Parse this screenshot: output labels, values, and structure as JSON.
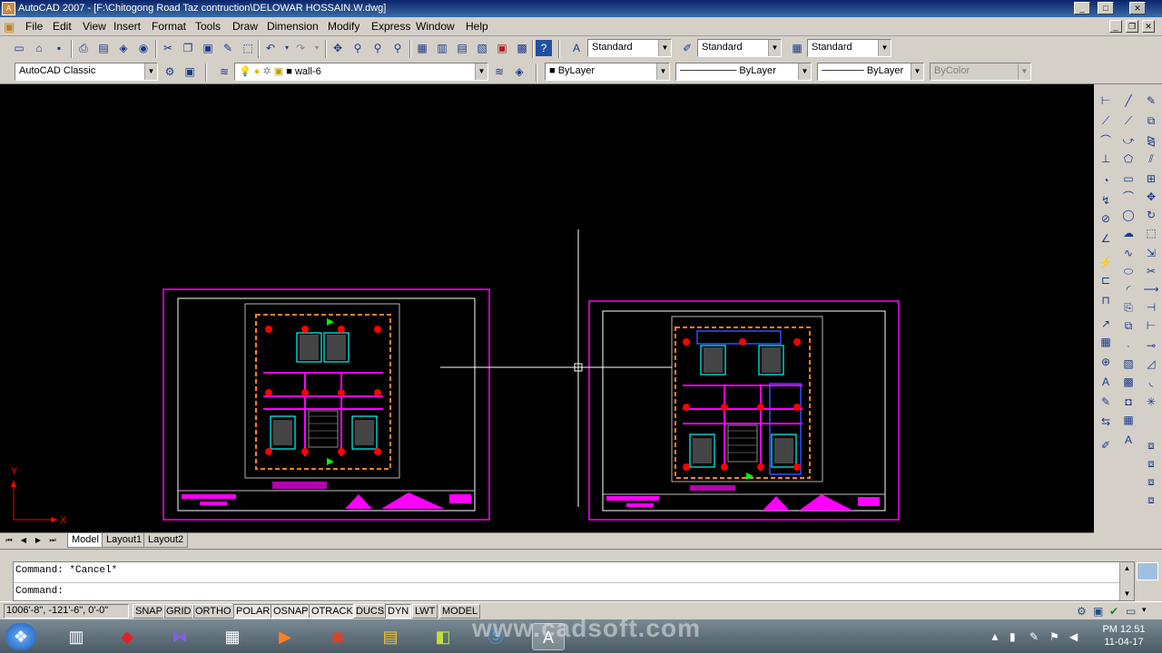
{
  "window": {
    "title": "AutoCAD 2007 - [F:\\Chitogong Road   Taz contruction\\DELOWAR HOSSAIN.W.dwg]",
    "app_icon": "A",
    "min": "_",
    "max": "□",
    "close": "✕",
    "doc_min": "_",
    "doc_restore": "❐",
    "doc_close": "✕"
  },
  "menu": [
    "File",
    "Edit",
    "View",
    "Insert",
    "Format",
    "Tools",
    "Draw",
    "Dimension",
    "Modify",
    "Express",
    "Window",
    "Help"
  ],
  "styles_toolbar": {
    "text_style": "Standard",
    "dim_style": "Standard",
    "table_style": "Standard"
  },
  "workspace": "AutoCAD Classic",
  "layer": "wall-6",
  "properties": {
    "color": "ByLayer",
    "linetype": "ByLayer",
    "lineweight": "ByLayer",
    "plotstyle": "ByColor"
  },
  "tabs": {
    "model": "Model",
    "layout1": "Layout1",
    "layout2": "Layout2"
  },
  "command": {
    "line1": "Command: *Cancel*",
    "line2": "Command:"
  },
  "status": {
    "coords": "1006'-8\", -121'-6\", 0'-0\"",
    "buttons": [
      "SNAP",
      "GRID",
      "ORTHO",
      "POLAR",
      "OSNAP",
      "OTRACK",
      "DUCS",
      "DYN",
      "LWT",
      "MODEL"
    ]
  },
  "ucs": {
    "x_label": "X",
    "y_label": "Y"
  },
  "taskbar": {
    "watermark": "www.cadsoft.com",
    "time": "PM 12.51",
    "date": "11-04-17"
  },
  "colors": {
    "magenta": "#ff00ff",
    "cyan": "#00ffff",
    "red": "#ff0000",
    "orange": "#ff7f27",
    "white": "#ffffff",
    "green": "#00ff00"
  }
}
